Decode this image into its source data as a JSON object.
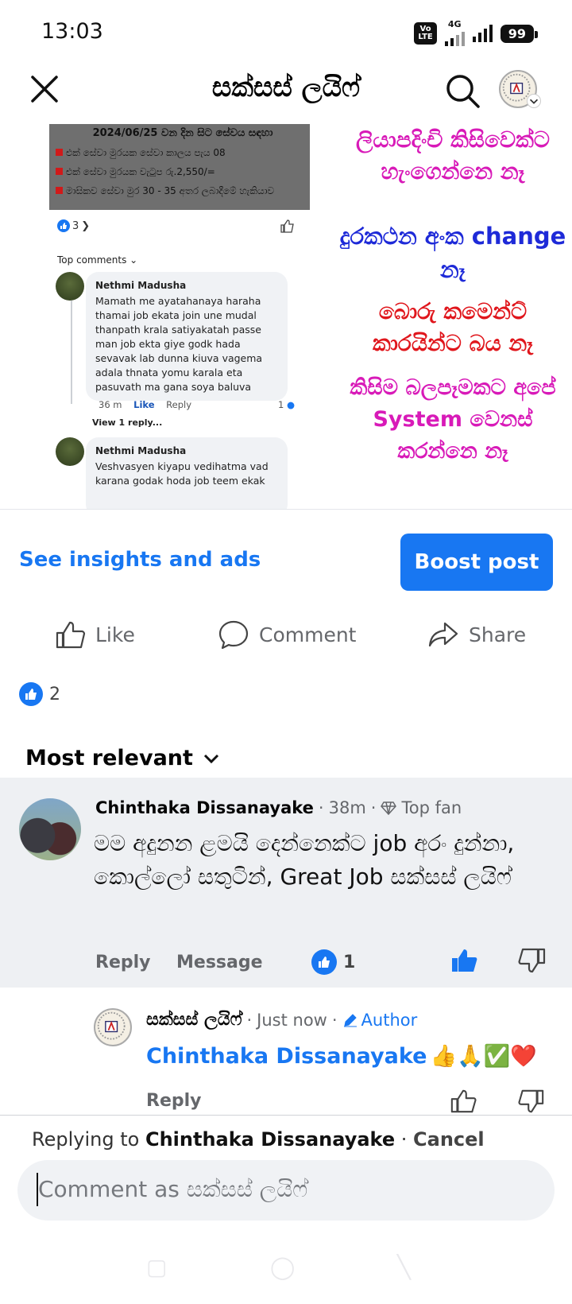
{
  "status_bar": {
    "time": "13:03",
    "volte": "Vo LTE",
    "network": "4G",
    "battery": "99"
  },
  "header": {
    "title": "සක්සස් ලයිෆ්"
  },
  "post_image": {
    "screenshot_lines": [
      "2024/06/25 වන දින සිට සේවය සඳහා",
      "එක් සේවා මුරයක සේවා කාලය පැය 08",
      "එක් සේවා මුරයක වැටුප රු.2,550/=",
      "මාසිකව සේවා මුර 30 - 35 අතර ලබාදීමේ හැකියාව"
    ],
    "reaction_count": "3",
    "top_comments_label": "Top comments",
    "comments": [
      {
        "name": "Nethmi Madusha",
        "text": "Mamath me ayatahanaya haraha thamai job ekata join une mudal thanpath  krala satiyakatah passe man job ekta giye godk hada sevavak lab dunna kiuva vagema adala thnata yomu karala eta pasuvath ma gana soya baluva",
        "time": "36 m",
        "like": "Like",
        "reply": "Reply",
        "reacts": "1"
      },
      {
        "name": "Nethmi Madusha",
        "text": "Veshvasyen kiyapu vedihatma vad karana godak hoda job teem ekak"
      }
    ],
    "view_reply": "View 1 reply...",
    "promo": {
      "line1": "ලියාපදිංචි කිසිවෙක්ට හැංගෙන්නෙ නෑ",
      "line2": "දුරකථන අංක change නෑ",
      "line3": "බොරු කමෙන්ට් කාරයින්ට බය නෑ",
      "line4": "කිසිම බලපෑමකට අපේ System වෙනස් කරන්නෙ නෑ"
    }
  },
  "post_actions": {
    "insights": "See insights and ads",
    "boost": "Boost post",
    "like": "Like",
    "comment": "Comment",
    "share": "Share",
    "like_count": "2"
  },
  "comments": {
    "sort_label": "Most relevant",
    "main": {
      "name": "Chinthaka Dissanayake",
      "time": "38m",
      "badge": "Top fan",
      "text": "මම අදුනන ළමයි දෙන්නෙක්ට job අරං දුන්නා, කොල්ලෝ සතුටින්, Great Job සක්සස් ලයිෆ්",
      "reply": "Reply",
      "message": "Message",
      "reaction_count": "1"
    },
    "reply": {
      "name": "සක්සස් ලයිෆ්",
      "time": "Just now",
      "badge": "Author",
      "mention": "Chinthaka Dissanayake",
      "emojis": "👍🙏✅❤️",
      "reply": "Reply"
    }
  },
  "composer": {
    "replying_prefix": "Replying to",
    "replying_name": "Chinthaka Dissanayake",
    "cancel": "Cancel",
    "placeholder": "Comment as සක්සස් ලයිෆ්"
  },
  "colors": {
    "accent": "#1877f2",
    "promo_magenta": "#d81ab8",
    "promo_blue": "#1e2ad8",
    "promo_red": "#e0161c",
    "comment_bg": "#eef0f3"
  }
}
